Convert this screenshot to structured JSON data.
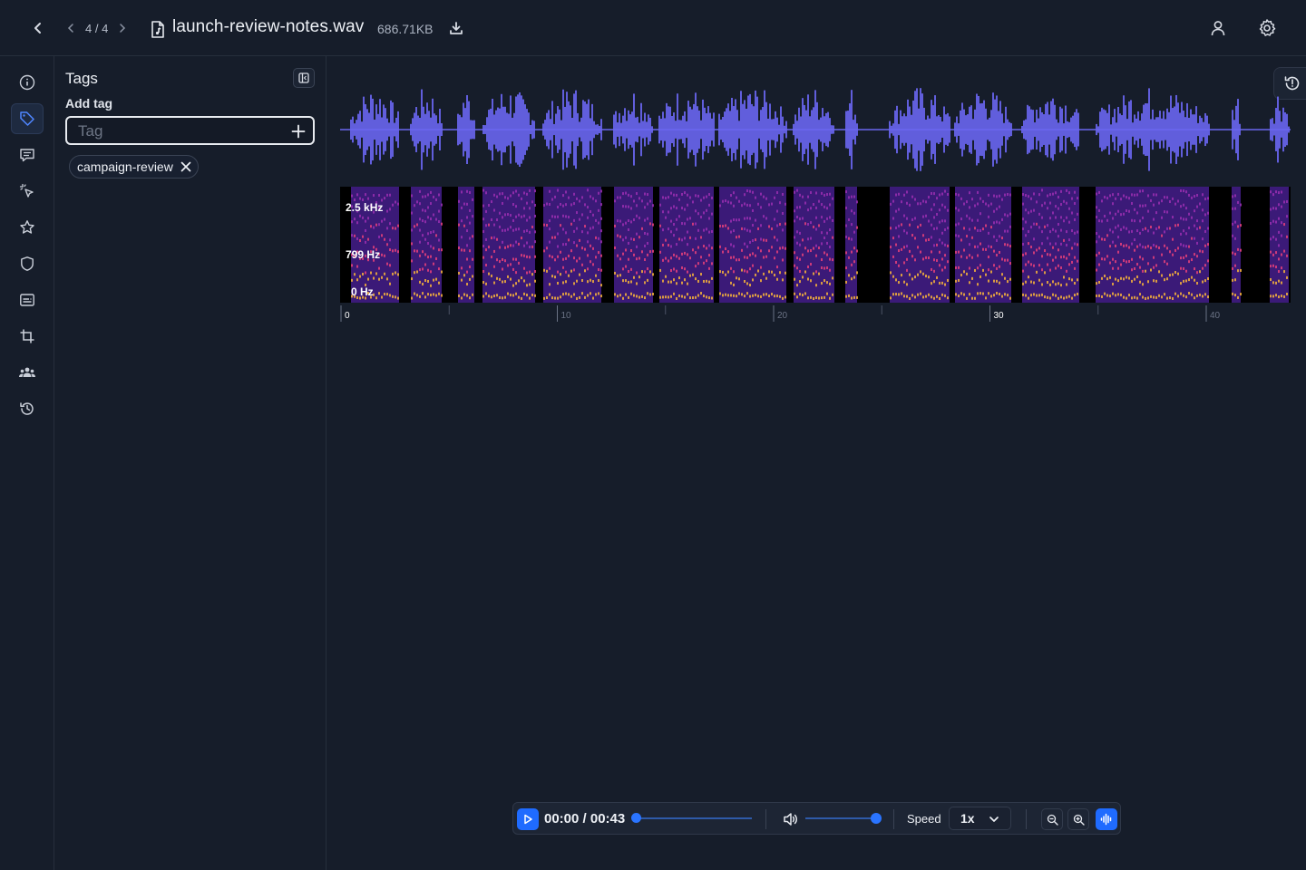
{
  "header": {
    "pager": "4 / 4",
    "file_name": "launch-review-notes.wav",
    "file_size": "686.71KB"
  },
  "sidebar": {
    "items": [
      {
        "icon": "info-icon",
        "active": false
      },
      {
        "icon": "tag-icon",
        "active": true
      },
      {
        "icon": "comment-icon",
        "active": false
      },
      {
        "icon": "sparkle-cursor-icon",
        "active": false
      },
      {
        "icon": "star-icon",
        "active": false
      },
      {
        "icon": "shield-icon",
        "active": false
      },
      {
        "icon": "caption-icon",
        "active": false
      },
      {
        "icon": "crop-icon",
        "active": false
      },
      {
        "icon": "team-icon",
        "active": false
      },
      {
        "icon": "history-icon",
        "active": false
      }
    ]
  },
  "tags_panel": {
    "title": "Tags",
    "add_label": "Add tag",
    "input_placeholder": "Tag",
    "input_value": "",
    "tags": [
      "campaign-review"
    ]
  },
  "waveform": {
    "color": "#6a66f0",
    "freq_labels": [
      "2.5 kHz",
      "799 Hz",
      "0 Hz"
    ],
    "timeline_major": [
      "0",
      "10",
      "20",
      "30",
      "40"
    ],
    "duration_seconds": 43
  },
  "player": {
    "time": "00:00 / 00:43",
    "progress": 0,
    "volume": 1.0,
    "speed_label": "Speed",
    "speed_value": "1x",
    "accent": "#1f6bff"
  }
}
